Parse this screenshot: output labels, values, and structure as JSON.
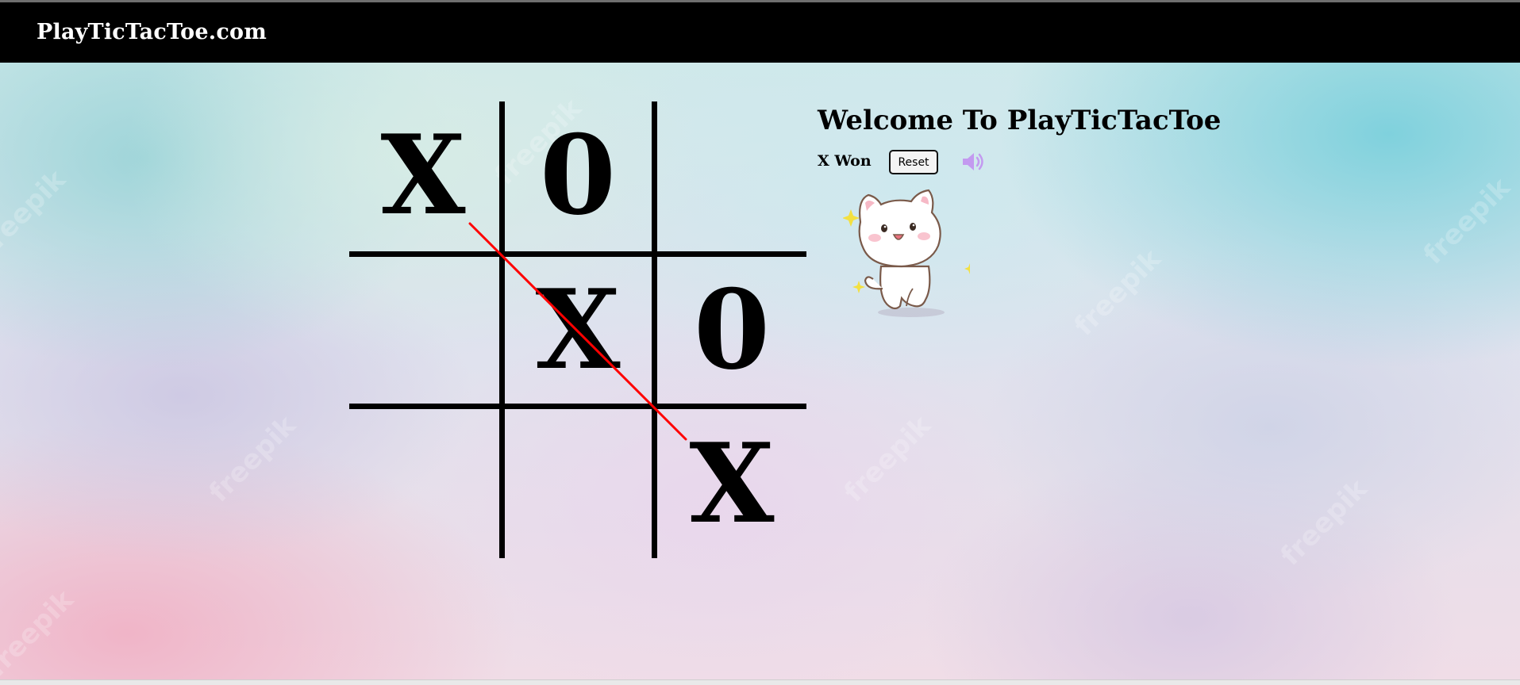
{
  "navbar": {
    "brand": "PlayTicTacToe.com"
  },
  "board": {
    "cells": [
      "X",
      "0",
      "",
      "",
      "X",
      "0",
      "",
      "",
      "X"
    ],
    "winning_line": [
      0,
      4,
      8
    ],
    "line_color": "#000000",
    "win_line_color": "#ff0000"
  },
  "panel": {
    "title": "Welcome To PlayTicTacToe",
    "status": "X Won",
    "reset_label": "Reset",
    "sound_icon": "speaker-volume-icon",
    "sound_color": "#c39af0",
    "mascot": "happy-cat-sticker"
  },
  "colors": {
    "navbar": "#000000",
    "brand_text": "#ffffff"
  }
}
